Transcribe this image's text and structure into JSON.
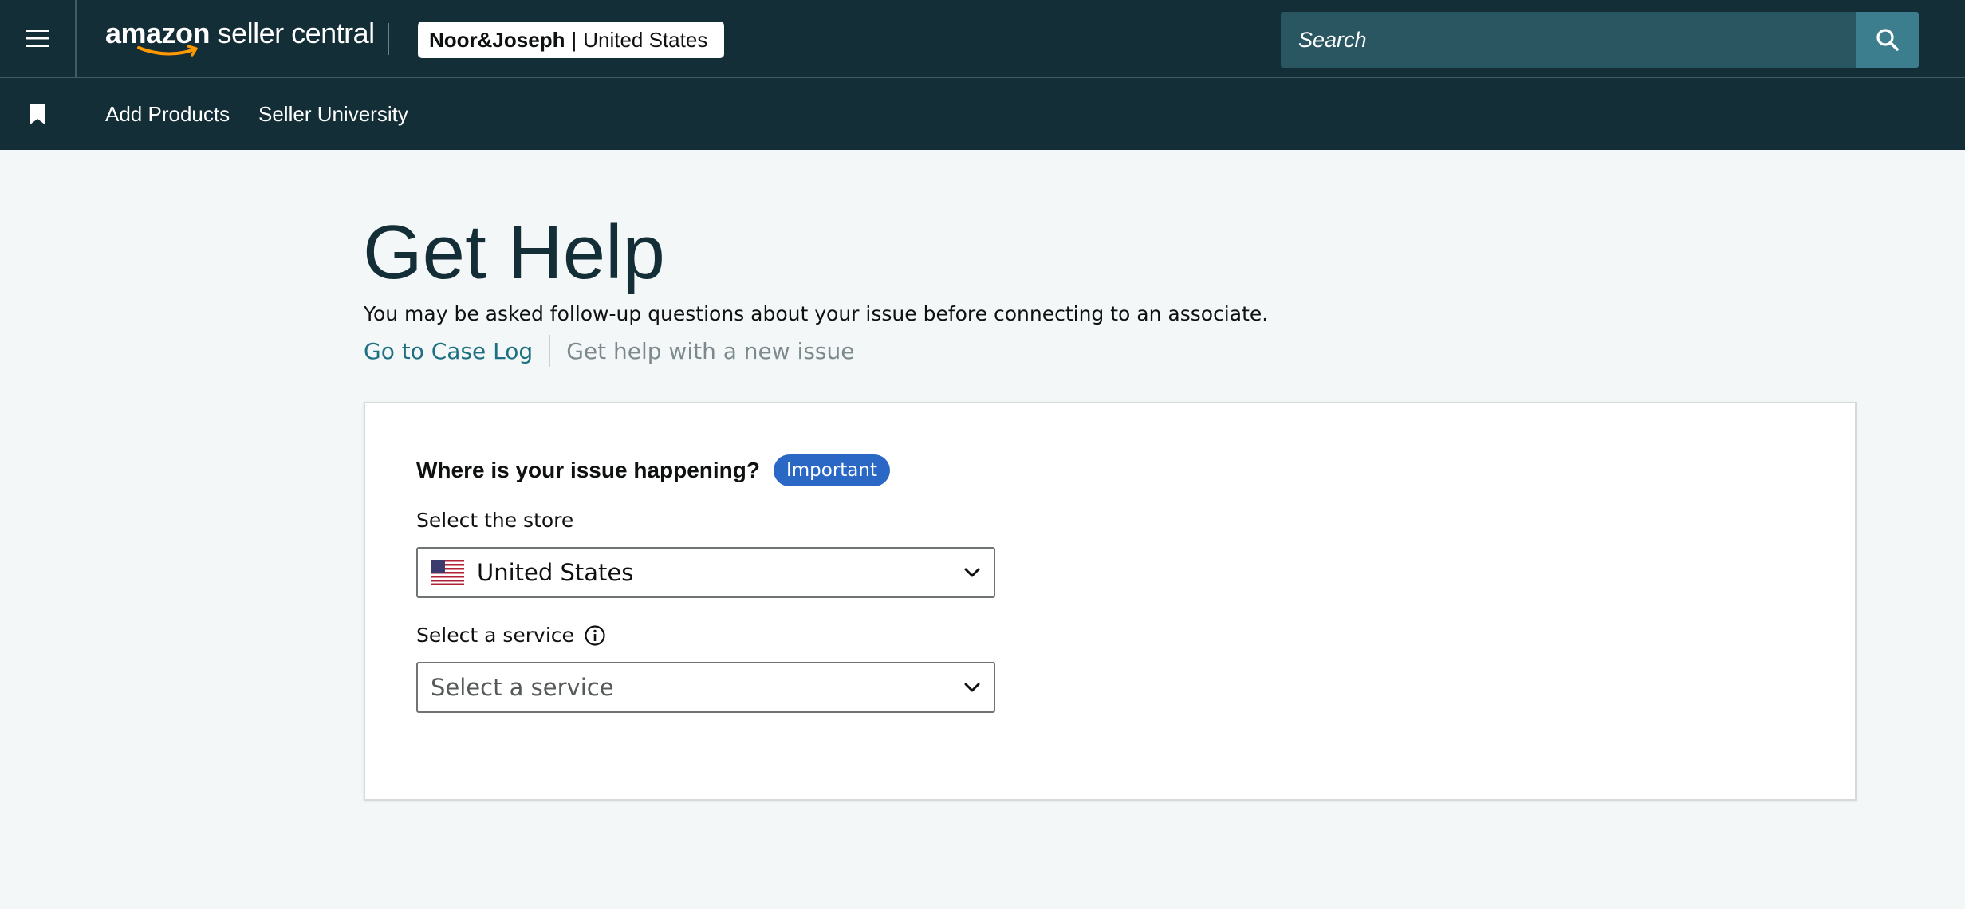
{
  "header": {
    "menu_icon": "hamburger-icon",
    "logo": {
      "brand": "amazon",
      "suffix": " seller central"
    },
    "store_badge": {
      "account": "Noor&Joseph",
      "separator": "|",
      "marketplace": "United States"
    },
    "search": {
      "placeholder": "Search",
      "value": "",
      "icon": "search-icon"
    },
    "colors": {
      "bar": "#132e37",
      "search_field": "#2a5662",
      "search_button": "#3d7e8e"
    }
  },
  "nav": {
    "bookmark_icon": "bookmark-icon",
    "links": [
      {
        "label": "Add Products"
      },
      {
        "label": "Seller University"
      }
    ]
  },
  "main": {
    "title": "Get Help",
    "subtitle": "You may be asked follow-up questions about your issue before connecting to an associate.",
    "links": {
      "case_log": "Go to Case Log",
      "new_issue": "Get help with a new issue"
    },
    "card": {
      "question": "Where is your issue happening?",
      "badge": "Important",
      "store_field": {
        "label": "Select the store",
        "value": "United States",
        "flag_icon": "us-flag-icon"
      },
      "service_field": {
        "label": "Select a service",
        "placeholder": "Select a service",
        "value": "",
        "info_icon": "info-icon"
      }
    },
    "colors": {
      "title": "#132e37",
      "link": "#1d7081",
      "badge": "#2b68c5",
      "background": "#f4f7f7"
    }
  }
}
